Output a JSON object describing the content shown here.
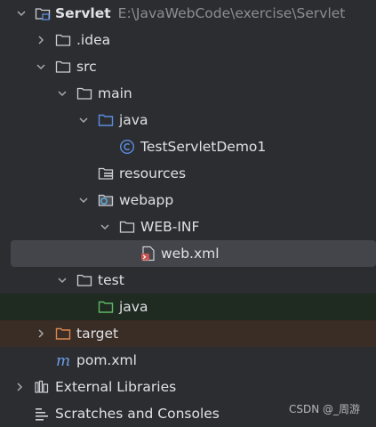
{
  "tree": {
    "root": {
      "name": "Servlet",
      "path": "E:\\JavaWebCode\\exercise\\Servlet",
      "icon": "module-folder-icon"
    },
    "nodes": [
      {
        "label": ".idea",
        "icon": "folder-icon"
      },
      {
        "label": "src",
        "icon": "folder-icon"
      },
      {
        "label": "main",
        "icon": "folder-icon"
      },
      {
        "label": "java",
        "icon": "source-root-folder-icon"
      },
      {
        "label": "TestServletDemo1",
        "icon": "java-class-icon"
      },
      {
        "label": "resources",
        "icon": "resources-folder-icon"
      },
      {
        "label": "webapp",
        "icon": "web-folder-icon"
      },
      {
        "label": "WEB-INF",
        "icon": "folder-icon"
      },
      {
        "label": "web.xml",
        "icon": "web-xml-icon"
      },
      {
        "label": "test",
        "icon": "folder-icon"
      },
      {
        "label": "java",
        "icon": "test-source-folder-icon"
      },
      {
        "label": "target",
        "icon": "excluded-folder-icon"
      },
      {
        "label": "pom.xml",
        "icon": "maven-icon"
      },
      {
        "label": "External Libraries",
        "icon": "libraries-icon"
      },
      {
        "label": "Scratches and Consoles",
        "icon": "scratches-icon"
      }
    ]
  },
  "colors": {
    "background": "#2b2d30",
    "selected_row": "#43454a",
    "test_row": "#1f2a21",
    "excluded_row": "#3a2d25",
    "text": "#dfe1e5",
    "path_text": "#8b8e94",
    "source_blue": "#5c8de0",
    "test_green": "#5fb865",
    "excluded_orange": "#d9864f",
    "maven_blue": "#6d9fe8"
  },
  "watermark": "CSDN @_周游"
}
